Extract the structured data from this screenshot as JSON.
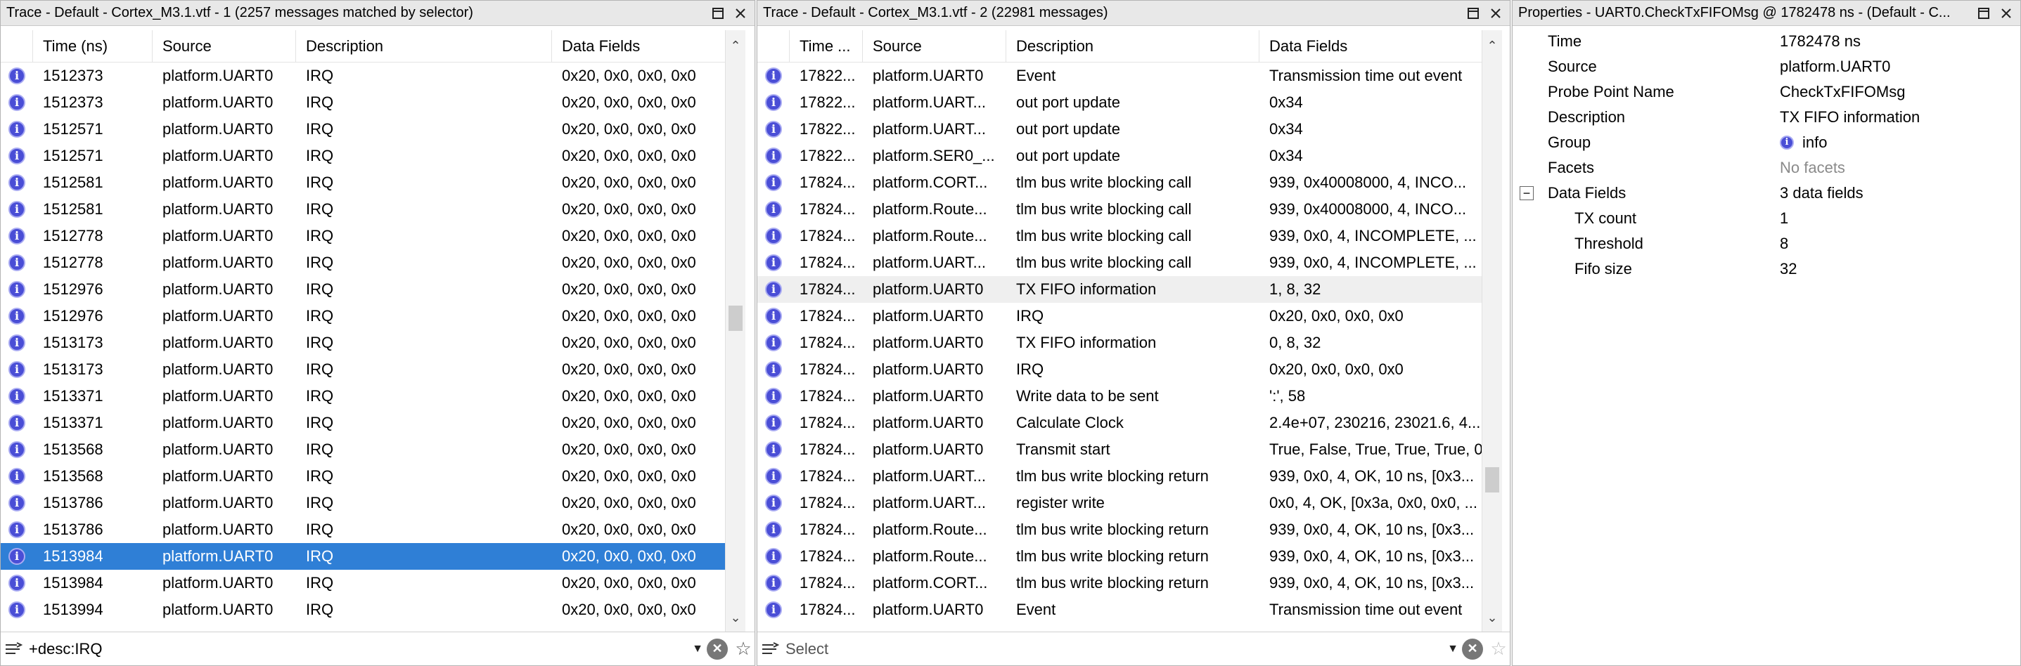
{
  "panel1": {
    "title": "Trace - Default - Cortex_M3.1.vtf - 1 (2257 messages matched by selector)",
    "columns": [
      "Time (ns)",
      "Source",
      "Description",
      "Data Fields"
    ],
    "filter_text": "+desc:IRQ",
    "rows": [
      {
        "t": "1512373",
        "s": "platform.UART0",
        "d": "IRQ",
        "f": "0x20, 0x0, 0x0, 0x0"
      },
      {
        "t": "1512373",
        "s": "platform.UART0",
        "d": "IRQ",
        "f": "0x20, 0x0, 0x0, 0x0"
      },
      {
        "t": "1512571",
        "s": "platform.UART0",
        "d": "IRQ",
        "f": "0x20, 0x0, 0x0, 0x0"
      },
      {
        "t": "1512571",
        "s": "platform.UART0",
        "d": "IRQ",
        "f": "0x20, 0x0, 0x0, 0x0"
      },
      {
        "t": "1512581",
        "s": "platform.UART0",
        "d": "IRQ",
        "f": "0x20, 0x0, 0x0, 0x0"
      },
      {
        "t": "1512581",
        "s": "platform.UART0",
        "d": "IRQ",
        "f": "0x20, 0x0, 0x0, 0x0"
      },
      {
        "t": "1512778",
        "s": "platform.UART0",
        "d": "IRQ",
        "f": "0x20, 0x0, 0x0, 0x0"
      },
      {
        "t": "1512778",
        "s": "platform.UART0",
        "d": "IRQ",
        "f": "0x20, 0x0, 0x0, 0x0"
      },
      {
        "t": "1512976",
        "s": "platform.UART0",
        "d": "IRQ",
        "f": "0x20, 0x0, 0x0, 0x0"
      },
      {
        "t": "1512976",
        "s": "platform.UART0",
        "d": "IRQ",
        "f": "0x20, 0x0, 0x0, 0x0"
      },
      {
        "t": "1513173",
        "s": "platform.UART0",
        "d": "IRQ",
        "f": "0x20, 0x0, 0x0, 0x0"
      },
      {
        "t": "1513173",
        "s": "platform.UART0",
        "d": "IRQ",
        "f": "0x20, 0x0, 0x0, 0x0"
      },
      {
        "t": "1513371",
        "s": "platform.UART0",
        "d": "IRQ",
        "f": "0x20, 0x0, 0x0, 0x0"
      },
      {
        "t": "1513371",
        "s": "platform.UART0",
        "d": "IRQ",
        "f": "0x20, 0x0, 0x0, 0x0"
      },
      {
        "t": "1513568",
        "s": "platform.UART0",
        "d": "IRQ",
        "f": "0x20, 0x0, 0x0, 0x0"
      },
      {
        "t": "1513568",
        "s": "platform.UART0",
        "d": "IRQ",
        "f": "0x20, 0x0, 0x0, 0x0"
      },
      {
        "t": "1513786",
        "s": "platform.UART0",
        "d": "IRQ",
        "f": "0x20, 0x0, 0x0, 0x0"
      },
      {
        "t": "1513786",
        "s": "platform.UART0",
        "d": "IRQ",
        "f": "0x20, 0x0, 0x0, 0x0"
      },
      {
        "t": "1513984",
        "s": "platform.UART0",
        "d": "IRQ",
        "f": "0x20, 0x0, 0x0, 0x0",
        "selected": true
      },
      {
        "t": "1513984",
        "s": "platform.UART0",
        "d": "IRQ",
        "f": "0x20, 0x0, 0x0, 0x0"
      },
      {
        "t": "1513994",
        "s": "platform.UART0",
        "d": "IRQ",
        "f": "0x20, 0x0, 0x0, 0x0"
      }
    ]
  },
  "panel2": {
    "title": "Trace - Default - Cortex_M3.1.vtf - 2 (22981 messages)",
    "columns": [
      "Time ...",
      "Source",
      "Description",
      "Data Fields"
    ],
    "filter_placeholder": "Select",
    "rows": [
      {
        "t": "17822...",
        "s": "platform.UART0",
        "d": "Event",
        "f": "Transmission time out event"
      },
      {
        "t": "17822...",
        "s": "platform.UART...",
        "d": "out port update",
        "f": "0x34"
      },
      {
        "t": "17822...",
        "s": "platform.UART...",
        "d": "out port update",
        "f": "0x34"
      },
      {
        "t": "17822...",
        "s": "platform.SER0_...",
        "d": "out port update",
        "f": "0x34"
      },
      {
        "t": "17824...",
        "s": "platform.CORT...",
        "d": "tlm bus write blocking call",
        "f": "939, 0x40008000, 4, INCO..."
      },
      {
        "t": "17824...",
        "s": "platform.Route...",
        "d": "tlm bus write blocking call",
        "f": "939, 0x40008000, 4, INCO..."
      },
      {
        "t": "17824...",
        "s": "platform.Route...",
        "d": "tlm bus write blocking call",
        "f": "939, 0x0, 4, INCOMPLETE, ..."
      },
      {
        "t": "17824...",
        "s": "platform.UART...",
        "d": "tlm bus write blocking call",
        "f": "939, 0x0, 4, INCOMPLETE, ..."
      },
      {
        "t": "17824...",
        "s": "platform.UART0",
        "d": "TX FIFO information",
        "f": "1, 8, 32",
        "highlight": true
      },
      {
        "t": "17824...",
        "s": "platform.UART0",
        "d": "IRQ",
        "f": "0x20, 0x0, 0x0, 0x0"
      },
      {
        "t": "17824...",
        "s": "platform.UART0",
        "d": "TX FIFO information",
        "f": "0, 8, 32"
      },
      {
        "t": "17824...",
        "s": "platform.UART0",
        "d": "IRQ",
        "f": "0x20, 0x0, 0x0, 0x0"
      },
      {
        "t": "17824...",
        "s": "platform.UART0",
        "d": "Write data to be sent",
        "f": "':', 58"
      },
      {
        "t": "17824...",
        "s": "platform.UART0",
        "d": "Calculate Clock",
        "f": "2.4e+07, 230216, 23021.6, 4..."
      },
      {
        "t": "17824...",
        "s": "platform.UART0",
        "d": "Transmit start",
        "f": "True, False, True, True, True, 0"
      },
      {
        "t": "17824...",
        "s": "platform.UART...",
        "d": "tlm bus write blocking return",
        "f": "939, 0x0, 4, OK, 10 ns, [0x3..."
      },
      {
        "t": "17824...",
        "s": "platform.UART...",
        "d": "register write",
        "f": "0x0, 4, OK, [0x3a, 0x0, 0x0, ..."
      },
      {
        "t": "17824...",
        "s": "platform.Route...",
        "d": "tlm bus write blocking return",
        "f": "939, 0x0, 4, OK, 10 ns, [0x3..."
      },
      {
        "t": "17824...",
        "s": "platform.Route...",
        "d": "tlm bus write blocking return",
        "f": "939, 0x0, 4, OK, 10 ns, [0x3..."
      },
      {
        "t": "17824...",
        "s": "platform.CORT...",
        "d": "tlm bus write blocking return",
        "f": "939, 0x0, 4, OK, 10 ns, [0x3..."
      },
      {
        "t": "17824...",
        "s": "platform.UART0",
        "d": "Event",
        "f": "Transmission time out event"
      }
    ]
  },
  "panel3": {
    "title": "Properties - UART0.CheckTxFIFOMsg @ 1782478 ns - (Default - C...",
    "props": [
      {
        "k": "Time",
        "v": "1782478 ns"
      },
      {
        "k": "Source",
        "v": "platform.UART0"
      },
      {
        "k": "Probe Point Name",
        "v": "CheckTxFIFOMsg"
      },
      {
        "k": "Description",
        "v": "TX FIFO information"
      },
      {
        "k": "Group",
        "v": "info",
        "icon": true
      },
      {
        "k": "Facets",
        "v": "No facets",
        "dim": true
      },
      {
        "k": "Data Fields",
        "v": "3 data fields",
        "expander": true
      },
      {
        "k": "TX count",
        "v": "1",
        "indent": true
      },
      {
        "k": "Threshold",
        "v": "8",
        "indent": true
      },
      {
        "k": "Fifo size",
        "v": "32",
        "indent": true
      }
    ]
  },
  "icons": {
    "info": "i",
    "expander": "−",
    "dropdown": "▼",
    "clear": "✕",
    "star": "☆",
    "scroll_up": "⌃",
    "scroll_down": "⌄"
  },
  "colors": {
    "selection": "#2f7fd6",
    "info_icon": "#4a4ed6"
  }
}
